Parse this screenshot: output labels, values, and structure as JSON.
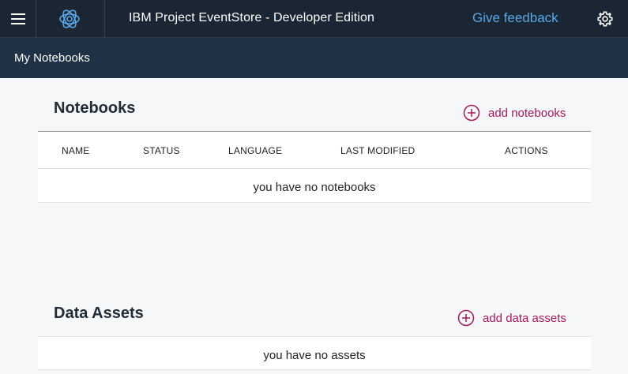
{
  "header": {
    "app_title": "IBM Project EventStore - Developer Edition",
    "feedback_label": "Give feedback",
    "logo_icon": "eventstore-logo-icon",
    "menu_icon": "hamburger-menu-icon",
    "settings_icon": "gear-icon"
  },
  "subheader": {
    "breadcrumb": "My Notebooks"
  },
  "notebooks": {
    "title": "Notebooks",
    "add_label": "add notebooks",
    "columns": [
      "NAME",
      "STATUS",
      "LANGUAGE",
      "LAST MODIFIED",
      "ACTIONS"
    ],
    "empty_message": "you have no notebooks"
  },
  "data_assets": {
    "title": "Data Assets",
    "add_label": "add data assets",
    "empty_message": "you have no assets"
  },
  "colors": {
    "topbar_bg": "#1a2634",
    "subbar_bg": "#1f3145",
    "accent_link": "#a2195b",
    "feedback_link": "#5aa7e6",
    "page_bg": "#f6f7f9"
  }
}
